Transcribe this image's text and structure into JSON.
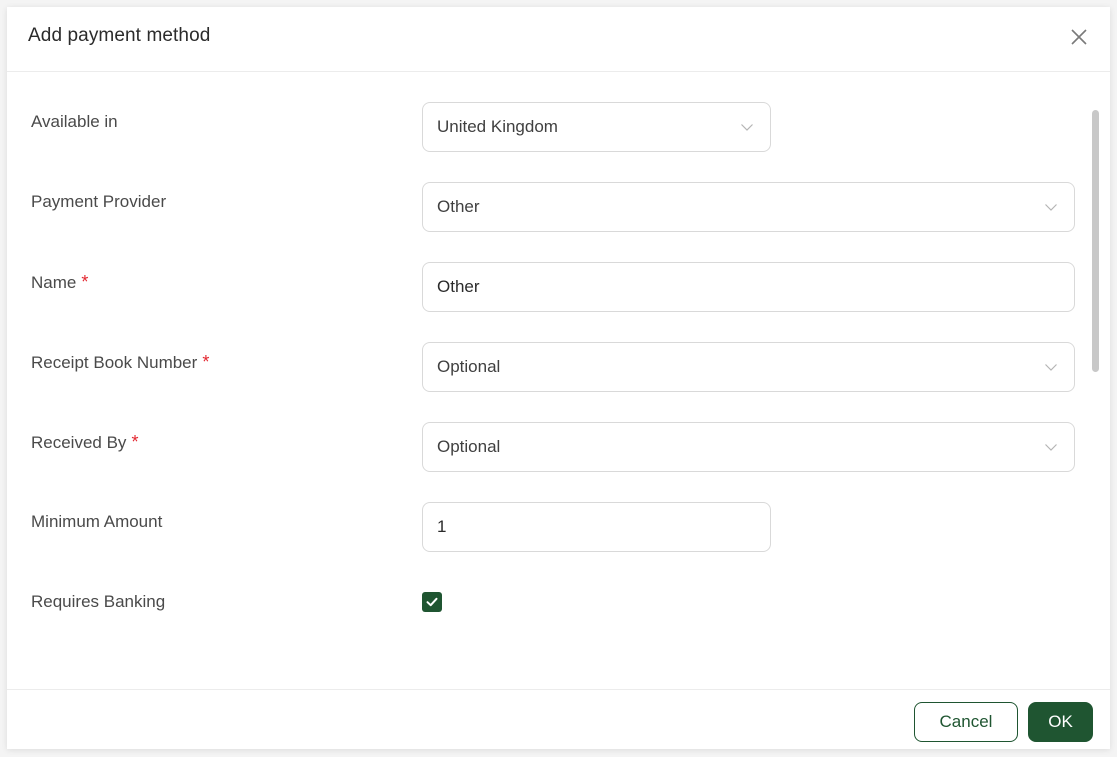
{
  "dialog": {
    "title": "Add payment method"
  },
  "form": {
    "available_in": {
      "label": "Available in",
      "value": "United Kingdom",
      "required": false
    },
    "payment_provider": {
      "label": "Payment Provider",
      "value": "Other",
      "required": false
    },
    "name": {
      "label": "Name",
      "value": "Other",
      "required": true
    },
    "receipt_book_number": {
      "label": "Receipt Book Number",
      "value": "Optional",
      "required": true
    },
    "received_by": {
      "label": "Received By",
      "value": "Optional",
      "required": true
    },
    "minimum_amount": {
      "label": "Minimum Amount",
      "value": "1",
      "required": false
    },
    "requires_banking": {
      "label": "Requires Banking",
      "checked": true,
      "required": false
    },
    "required_marker": "*"
  },
  "footer": {
    "cancel_label": "Cancel",
    "ok_label": "OK"
  },
  "colors": {
    "accent": "#1f5531",
    "required": "#e3262f"
  }
}
